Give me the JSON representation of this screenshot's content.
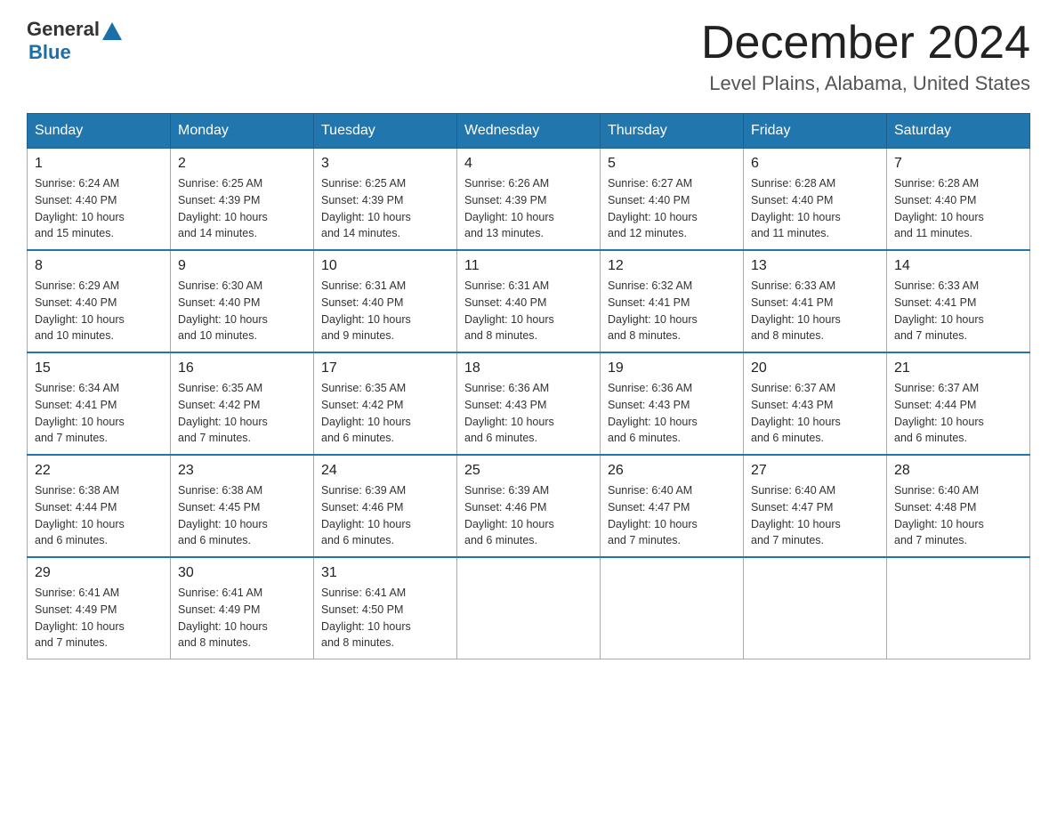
{
  "header": {
    "logo_general": "General",
    "logo_blue": "Blue",
    "month_title": "December 2024",
    "location": "Level Plains, Alabama, United States"
  },
  "days_of_week": [
    "Sunday",
    "Monday",
    "Tuesday",
    "Wednesday",
    "Thursday",
    "Friday",
    "Saturday"
  ],
  "weeks": [
    [
      {
        "day": "1",
        "sunrise": "6:24 AM",
        "sunset": "4:40 PM",
        "daylight": "10 hours and 15 minutes."
      },
      {
        "day": "2",
        "sunrise": "6:25 AM",
        "sunset": "4:39 PM",
        "daylight": "10 hours and 14 minutes."
      },
      {
        "day": "3",
        "sunrise": "6:25 AM",
        "sunset": "4:39 PM",
        "daylight": "10 hours and 14 minutes."
      },
      {
        "day": "4",
        "sunrise": "6:26 AM",
        "sunset": "4:39 PM",
        "daylight": "10 hours and 13 minutes."
      },
      {
        "day": "5",
        "sunrise": "6:27 AM",
        "sunset": "4:40 PM",
        "daylight": "10 hours and 12 minutes."
      },
      {
        "day": "6",
        "sunrise": "6:28 AM",
        "sunset": "4:40 PM",
        "daylight": "10 hours and 11 minutes."
      },
      {
        "day": "7",
        "sunrise": "6:28 AM",
        "sunset": "4:40 PM",
        "daylight": "10 hours and 11 minutes."
      }
    ],
    [
      {
        "day": "8",
        "sunrise": "6:29 AM",
        "sunset": "4:40 PM",
        "daylight": "10 hours and 10 minutes."
      },
      {
        "day": "9",
        "sunrise": "6:30 AM",
        "sunset": "4:40 PM",
        "daylight": "10 hours and 10 minutes."
      },
      {
        "day": "10",
        "sunrise": "6:31 AM",
        "sunset": "4:40 PM",
        "daylight": "10 hours and 9 minutes."
      },
      {
        "day": "11",
        "sunrise": "6:31 AM",
        "sunset": "4:40 PM",
        "daylight": "10 hours and 8 minutes."
      },
      {
        "day": "12",
        "sunrise": "6:32 AM",
        "sunset": "4:41 PM",
        "daylight": "10 hours and 8 minutes."
      },
      {
        "day": "13",
        "sunrise": "6:33 AM",
        "sunset": "4:41 PM",
        "daylight": "10 hours and 8 minutes."
      },
      {
        "day": "14",
        "sunrise": "6:33 AM",
        "sunset": "4:41 PM",
        "daylight": "10 hours and 7 minutes."
      }
    ],
    [
      {
        "day": "15",
        "sunrise": "6:34 AM",
        "sunset": "4:41 PM",
        "daylight": "10 hours and 7 minutes."
      },
      {
        "day": "16",
        "sunrise": "6:35 AM",
        "sunset": "4:42 PM",
        "daylight": "10 hours and 7 minutes."
      },
      {
        "day": "17",
        "sunrise": "6:35 AM",
        "sunset": "4:42 PM",
        "daylight": "10 hours and 6 minutes."
      },
      {
        "day": "18",
        "sunrise": "6:36 AM",
        "sunset": "4:43 PM",
        "daylight": "10 hours and 6 minutes."
      },
      {
        "day": "19",
        "sunrise": "6:36 AM",
        "sunset": "4:43 PM",
        "daylight": "10 hours and 6 minutes."
      },
      {
        "day": "20",
        "sunrise": "6:37 AM",
        "sunset": "4:43 PM",
        "daylight": "10 hours and 6 minutes."
      },
      {
        "day": "21",
        "sunrise": "6:37 AM",
        "sunset": "4:44 PM",
        "daylight": "10 hours and 6 minutes."
      }
    ],
    [
      {
        "day": "22",
        "sunrise": "6:38 AM",
        "sunset": "4:44 PM",
        "daylight": "10 hours and 6 minutes."
      },
      {
        "day": "23",
        "sunrise": "6:38 AM",
        "sunset": "4:45 PM",
        "daylight": "10 hours and 6 minutes."
      },
      {
        "day": "24",
        "sunrise": "6:39 AM",
        "sunset": "4:46 PM",
        "daylight": "10 hours and 6 minutes."
      },
      {
        "day": "25",
        "sunrise": "6:39 AM",
        "sunset": "4:46 PM",
        "daylight": "10 hours and 6 minutes."
      },
      {
        "day": "26",
        "sunrise": "6:40 AM",
        "sunset": "4:47 PM",
        "daylight": "10 hours and 7 minutes."
      },
      {
        "day": "27",
        "sunrise": "6:40 AM",
        "sunset": "4:47 PM",
        "daylight": "10 hours and 7 minutes."
      },
      {
        "day": "28",
        "sunrise": "6:40 AM",
        "sunset": "4:48 PM",
        "daylight": "10 hours and 7 minutes."
      }
    ],
    [
      {
        "day": "29",
        "sunrise": "6:41 AM",
        "sunset": "4:49 PM",
        "daylight": "10 hours and 7 minutes."
      },
      {
        "day": "30",
        "sunrise": "6:41 AM",
        "sunset": "4:49 PM",
        "daylight": "10 hours and 8 minutes."
      },
      {
        "day": "31",
        "sunrise": "6:41 AM",
        "sunset": "4:50 PM",
        "daylight": "10 hours and 8 minutes."
      },
      null,
      null,
      null,
      null
    ]
  ],
  "labels": {
    "sunrise": "Sunrise:",
    "sunset": "Sunset:",
    "daylight": "Daylight:"
  }
}
